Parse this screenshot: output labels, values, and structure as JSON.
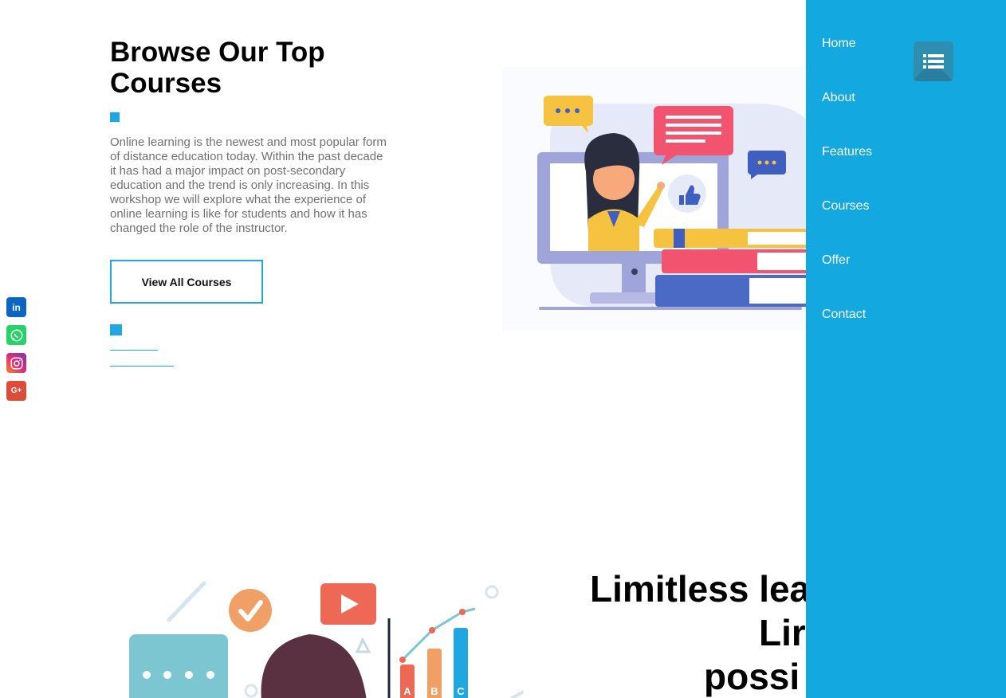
{
  "hero": {
    "title": "Browse Our Top Courses",
    "description": "Online learning is the newest and most popular form of distance education today. Within the past decade it has had a major impact on post-secondary education and the trend is only increasing. In this workshop we will explore what the experience of online learning is like for students and how it has changed the role of the instructor.",
    "button_label": "View All Courses"
  },
  "nav": {
    "items": [
      "Home",
      "About",
      "Features",
      "Courses",
      "Offer",
      "Contact"
    ]
  },
  "social": {
    "linkedin_glyph": "in",
    "googleplus_glyph": "G+"
  },
  "illustration_labels": {
    "a": "A",
    "b": "B",
    "c": "C"
  },
  "section2": {
    "line1": "Limitless lea",
    "line2": "Lir",
    "line3": "possi"
  },
  "colors": {
    "accent": "#1EA7E0",
    "panel": "#13A8DF",
    "linkedin": "#0A66C2",
    "whatsapp": "#25D366",
    "instagram": "#C13584",
    "googleplus": "#DD4B39"
  }
}
